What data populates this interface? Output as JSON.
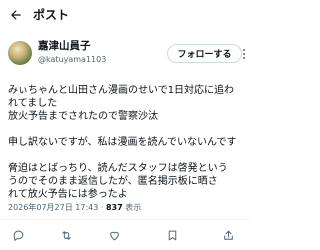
{
  "header": {
    "title": "ポスト"
  },
  "author": {
    "display_name": "嘉津山員子",
    "handle": "@katuyama1103",
    "follow_label": "フォローする"
  },
  "post": {
    "lines": [
      "みぃちゃんと山田さん漫画のせいで1日対応に追わ",
      "れてました",
      "放火予告までされたので警察沙汰",
      "",
      "申し訳ないですが、私は漫画を読んでいないんです",
      "",
      "脅迫はとばっちり、読んだスタッフは啓発という",
      "うのでそのまま返信したが、匿名掲示板に晒さ",
      "れて放火予告には参ったよ"
    ],
    "timestamp": "2026年07月27日 17:43 · ",
    "views_count": "837",
    "views_label": " 表示"
  },
  "actions": {
    "reply_count": "",
    "repost_count": "",
    "like_count": ""
  },
  "icons": {
    "back": "back-arrow-icon",
    "reply": "reply-icon",
    "repost": "repost-icon",
    "like": "heart-icon",
    "bookmark": "bookmark-icon",
    "share": "share-icon",
    "more": "more-icon"
  }
}
